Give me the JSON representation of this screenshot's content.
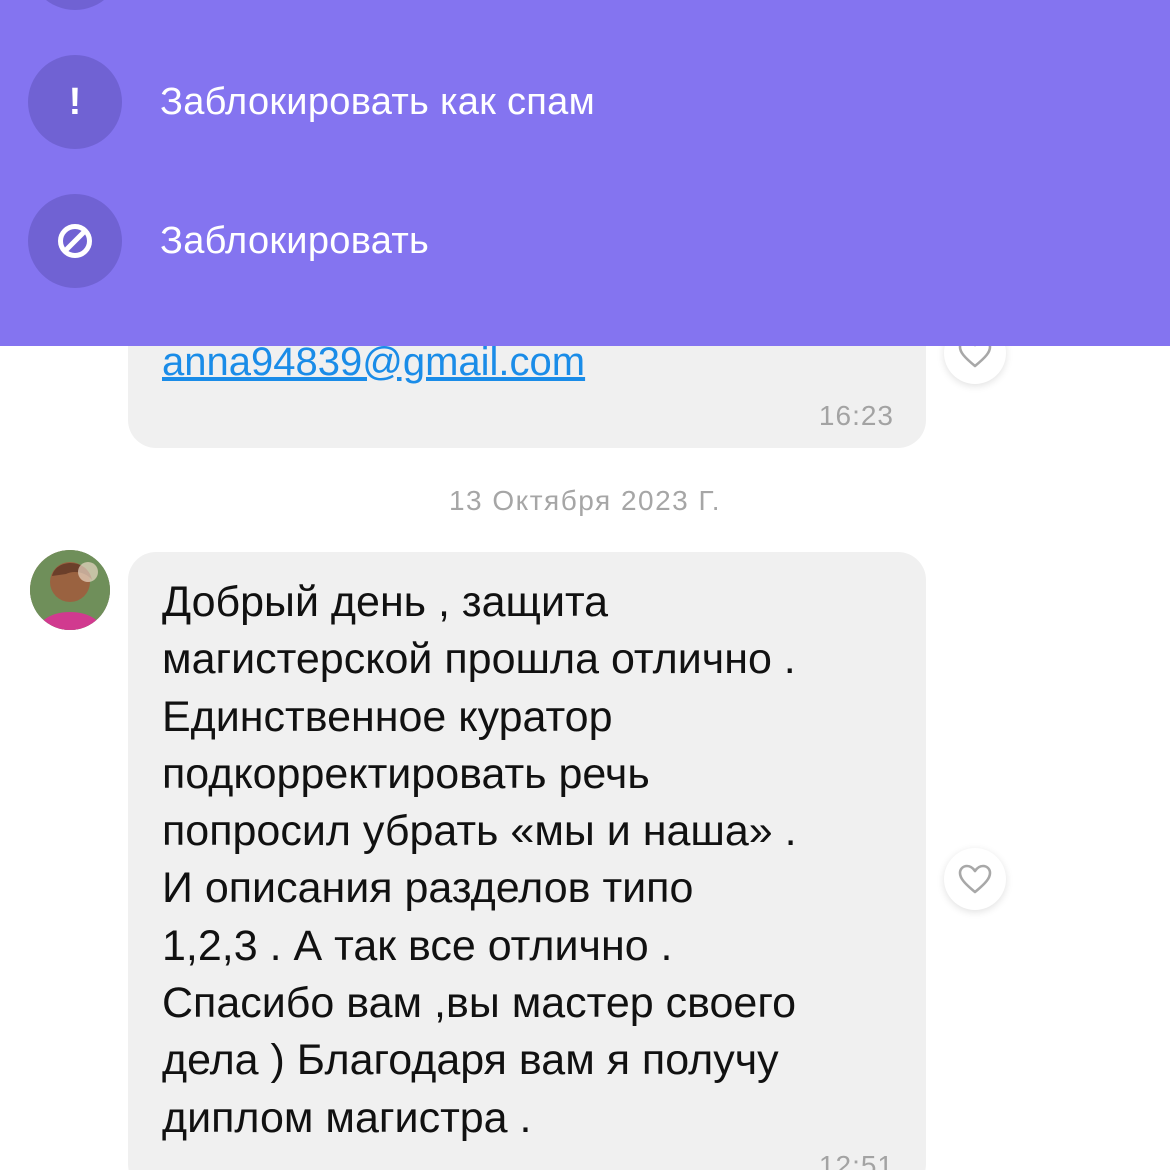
{
  "menu": {
    "items": [
      {
        "label": "Заблокировать как спам",
        "icon": "exclamation-icon"
      },
      {
        "label": "Заблокировать",
        "icon": "block-icon"
      }
    ],
    "colors": {
      "background": "#8474f0",
      "icon_circle": "#7062d3"
    }
  },
  "chat": {
    "messages": [
      {
        "email": "anna94839@gmail.com",
        "time": "16:23",
        "liked": false
      },
      {
        "text": "Добрый день , защита\nмагистерской прошла отлично .\nЕдинственное куратор\nподкорректировать речь\nпопросил убрать «мы и наша» .\nИ описания разделов типо\n1,2,3 . А так все отлично .\nСпасибо вам ,вы мастер своего\nдела ) Благодаря вам я получу\nдиплом магистра .",
        "time": "12:51",
        "liked": false
      }
    ],
    "date_separator": "13 Октября 2023 Г.",
    "colors": {
      "bubble": "#f0f0f0",
      "link": "#1a8ce8",
      "meta": "#a3a3a3"
    }
  }
}
